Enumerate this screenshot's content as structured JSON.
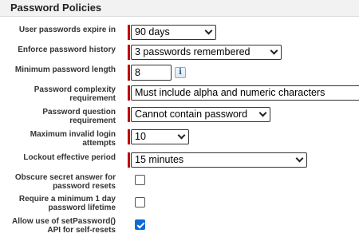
{
  "header": {
    "title": "Password Policies"
  },
  "fields": {
    "expire": {
      "label": "User passwords expire in",
      "value": "90 days"
    },
    "history": {
      "label": "Enforce password history",
      "value": "3 passwords remembered"
    },
    "min_length": {
      "label": "Minimum password length",
      "value": "8",
      "info_icon": "i"
    },
    "complexity": {
      "label": "Password complexity requirement",
      "value": "Must include alpha and numeric characters"
    },
    "question": {
      "label": "Password question requirement",
      "value": "Cannot contain password"
    },
    "max_attempts": {
      "label": "Maximum invalid login attempts",
      "value": "10"
    },
    "lockout": {
      "label": "Lockout effective period",
      "value": "15 minutes"
    },
    "obscure": {
      "label": "Obscure secret answer for password resets",
      "checked": false
    },
    "min_lifetime": {
      "label": "Require a minimum 1 day password lifetime",
      "checked": false
    },
    "setpassword": {
      "label": "Allow use of setPassword() API for self-resets",
      "checked": true
    }
  },
  "colors": {
    "required_bar": "#c00000",
    "checkbox_checked": "#0b6cd3",
    "header_bg": "#f2f2f2"
  }
}
